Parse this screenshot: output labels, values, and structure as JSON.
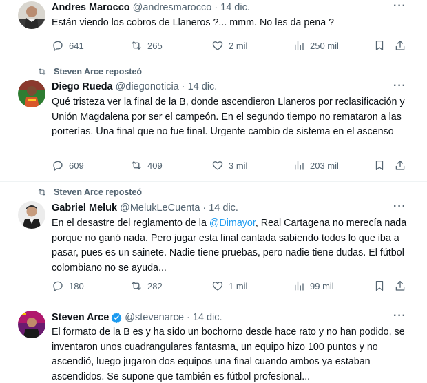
{
  "tweets": [
    {
      "repost_label": "",
      "name": "Andres Marocco",
      "handle": "@andresmarocco",
      "dot": "·",
      "date": "14 dic.",
      "text_before": "Están viendo los cobros de Llaneros ?... mmm. No les da pena ?",
      "mention": "",
      "text_after": "",
      "replies": "641",
      "reposts": "265",
      "likes": "2 mil",
      "views": "250 mil",
      "more": "···"
    },
    {
      "repost_label": "Steven Arce reposteó",
      "name": "Diego Rueda",
      "handle": "@diegonoticia",
      "dot": "·",
      "date": "14 dic.",
      "text_before": "Qué tristeza ver la final de la B, donde ascendieron Llaneros por reclasificación y Unión Magdalena por ser el campeón. En el segundo tiempo no remataron a las porterías. Una final que no fue final. Urgente cambio de sistema en el ascenso",
      "mention": "",
      "text_after": "",
      "replies": "609",
      "reposts": "409",
      "likes": "3 mil",
      "views": "203 mil",
      "more": "···"
    },
    {
      "repost_label": "Steven Arce reposteó",
      "name": "Gabriel Meluk",
      "handle": "@MelukLeCuenta",
      "dot": "·",
      "date": "14 dic.",
      "text_before": "En el desastre del reglamento de la ",
      "mention": "@Dimayor",
      "text_after": ", Real Cartagena no merecía nada porque no ganó nada. Pero jugar esta final cantada sabiendo todos lo que iba a pasar, pues es un sainete. Nadie tiene pruebas, pero nadie tiene dudas. El fútbol colombiano no se ayuda...",
      "replies": "180",
      "reposts": "282",
      "likes": "1 mil",
      "views": "99 mil",
      "more": "···"
    },
    {
      "repost_label": "",
      "name": "Steven Arce",
      "handle": "@stevenarce",
      "dot": "·",
      "date": "14 dic.",
      "text_before": "El formato de la B es y ha sido un bochorno desde hace rato y no han podido, se inventaron unos cuadrangulares fantasma, un equipo hizo 100 puntos y no ascendió, luego jugaron dos equipos una final cuando ambos ya estaban ascendidos. Se supone que también es fútbol profesional...",
      "mention": "",
      "text_after": "",
      "replies": "",
      "reposts": "",
      "likes": "",
      "views": "",
      "more": "···"
    }
  ],
  "colors": {
    "accent": "#1d9bf0",
    "muted": "#536471",
    "text": "#0f1419",
    "border": "#eff3f4"
  },
  "icons": [
    "repost-icon",
    "reply-icon",
    "retweet-icon",
    "like-icon",
    "views-icon",
    "bookmark-icon",
    "share-icon",
    "verified-badge-icon",
    "more-icon"
  ]
}
